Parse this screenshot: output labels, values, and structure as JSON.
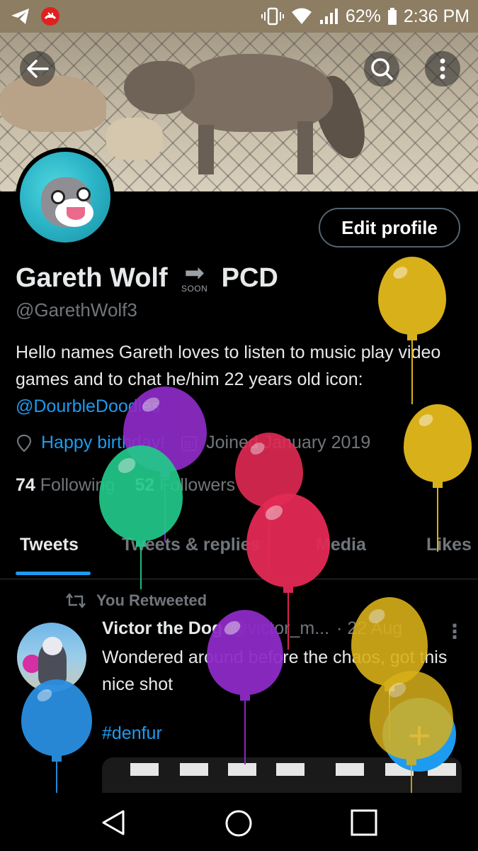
{
  "status_bar": {
    "battery": "62%",
    "time": "2:36 PM"
  },
  "profile": {
    "name_part1": "Gareth Wolf",
    "soon_label": "SOON",
    "name_part2": "PCD",
    "handle": "@GarethWolf3",
    "bio_text": "Hello names Gareth loves to listen to music play video games and to chat he/him 22 years old icon:",
    "bio_link": "@DourbleDoodles",
    "location": "Happy birthday!",
    "joined": "Joined January 2019",
    "following_count": "74",
    "following_label": "Following",
    "followers_count": "52",
    "followers_label": "Followers",
    "edit_label": "Edit profile"
  },
  "tabs": [
    "Tweets",
    "Tweets & replies",
    "Media",
    "Likes"
  ],
  "tweet": {
    "retweet_label": "You Retweeted",
    "author": "Victor the Dog",
    "handle": "@victor_m...",
    "date": "· 22 Aug",
    "text": "Wondered around before the chaos, got this nice shot",
    "hashtag": "#denfur"
  },
  "fab_label": "+",
  "colors": {
    "accent": "#1d9bf0",
    "background": "#000000",
    "status_bar": "#8c7d63",
    "balloon_gold": "#d8b01a",
    "balloon_purple": "#8e2bc7",
    "balloon_green": "#22c98a",
    "balloon_red": "#e32a55",
    "balloon_blue": "#2a8fe0"
  },
  "icons": {
    "back": "back-arrow-icon",
    "search": "search-icon",
    "more": "more-vertical-icon",
    "location": "location-pin-icon",
    "calendar": "calendar-icon",
    "retweet": "retweet-icon",
    "nav_back": "nav-back-icon",
    "nav_home": "nav-home-icon",
    "nav_recents": "nav-recents-icon"
  }
}
